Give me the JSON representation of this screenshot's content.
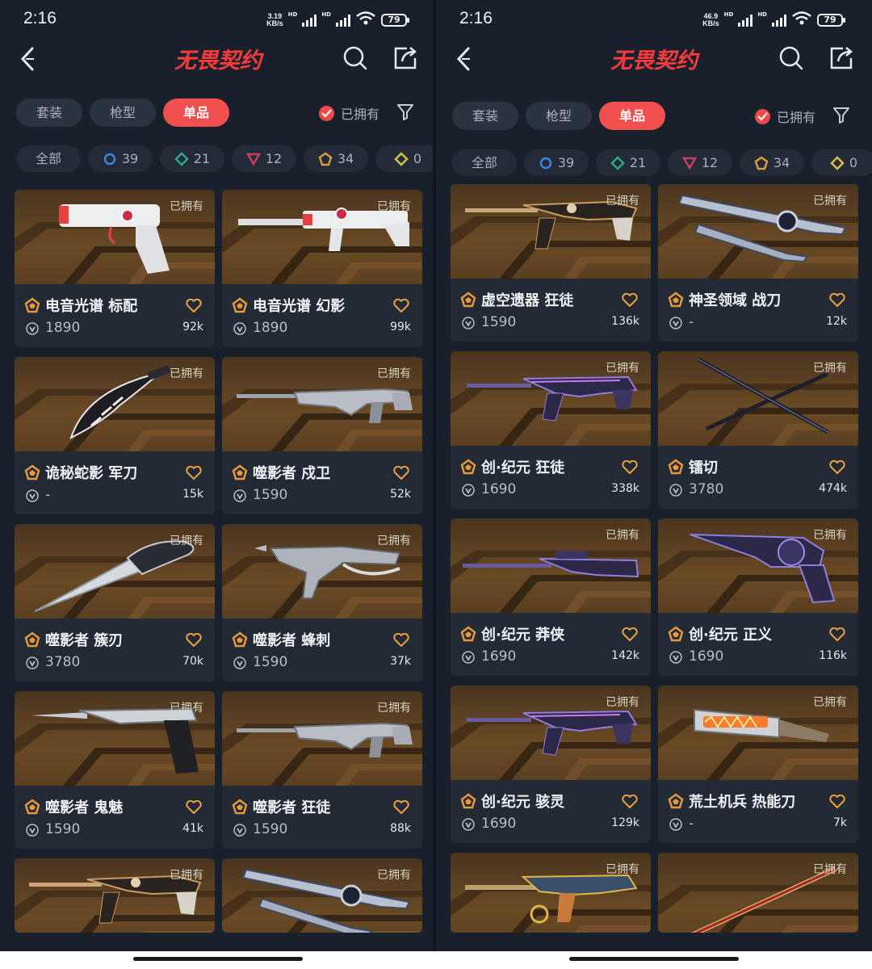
{
  "status": {
    "time": "2:16",
    "battery": "79",
    "left_speed_value": "3.19",
    "right_speed_value": "46.9",
    "speed_unit": "KB/s",
    "hd_label": "HD",
    "wifi_badge": "6"
  },
  "header": {
    "logo_text": "无畏契约"
  },
  "tabs": {
    "items": [
      "套装",
      "枪型",
      "单品"
    ],
    "active": "单品"
  },
  "owned_filter_label": "已拥有",
  "tiers": [
    {
      "label": "全部",
      "count": ""
    },
    {
      "label": "",
      "count": "39",
      "color": "#3f84d6",
      "shape": "circle"
    },
    {
      "label": "",
      "count": "21",
      "color": "#2ea889",
      "shape": "diamond"
    },
    {
      "label": "",
      "count": "12",
      "color": "#c8405e",
      "shape": "triangle"
    },
    {
      "label": "",
      "count": "34",
      "color": "#e09a3a",
      "shape": "pentagon"
    },
    {
      "label": "",
      "count": "0",
      "color": "#d6c04a",
      "shape": "diamond"
    }
  ],
  "owned_badge": "已拥有",
  "left_items": [
    {
      "name": "电音光谱 标配",
      "price": "1890",
      "likes": "92k",
      "art": "white-pistol"
    },
    {
      "name": "电音光谱 幻影",
      "price": "1890",
      "likes": "99k",
      "art": "white-rifle"
    },
    {
      "name": "诡秘蛇影 军刀",
      "price": "-",
      "likes": "15k",
      "art": "black-blade"
    },
    {
      "name": "噬影者 戍卫",
      "price": "1590",
      "likes": "52k",
      "art": "grey-rifle"
    },
    {
      "name": "噬影者 簇刃",
      "price": "3780",
      "likes": "70k",
      "art": "silver-knife"
    },
    {
      "name": "噬影者 蜂刺",
      "price": "1590",
      "likes": "37k",
      "art": "grey-smg"
    },
    {
      "name": "噬影者 鬼魅",
      "price": "1590",
      "likes": "41k",
      "art": "grey-pistol"
    },
    {
      "name": "噬影者 狂徒",
      "price": "1590",
      "likes": "88k",
      "art": "grey-rifle2"
    },
    {
      "name": "",
      "price": "",
      "likes": "",
      "art": "gold-rifle"
    },
    {
      "name": "",
      "price": "",
      "likes": "",
      "art": "blue-blade"
    }
  ],
  "right_items": [
    {
      "name": "虚空遗器 狂徒",
      "price": "1590",
      "likes": "136k",
      "art": "gold-rifle"
    },
    {
      "name": "神圣领域 战刀",
      "price": "-",
      "likes": "12k",
      "art": "blue-blade"
    },
    {
      "name": "创·纪元 狂徒",
      "price": "1690",
      "likes": "338k",
      "art": "purple-rifle"
    },
    {
      "name": "镭切",
      "price": "3780",
      "likes": "474k",
      "art": "katana"
    },
    {
      "name": "创·纪元 莽侠",
      "price": "1690",
      "likes": "142k",
      "art": "purple-sniper"
    },
    {
      "name": "创·纪元 正义",
      "price": "1690",
      "likes": "116k",
      "art": "purple-revolver"
    },
    {
      "name": "创·纪元 骇灵",
      "price": "1690",
      "likes": "129k",
      "art": "purple-smg"
    },
    {
      "name": "荒土机兵 热能刀",
      "price": "-",
      "likes": "7k",
      "art": "heat-knife"
    },
    {
      "name": "",
      "price": "",
      "likes": "",
      "art": "multi-rifle"
    },
    {
      "name": "",
      "price": "",
      "likes": "",
      "art": "red-staff"
    }
  ]
}
